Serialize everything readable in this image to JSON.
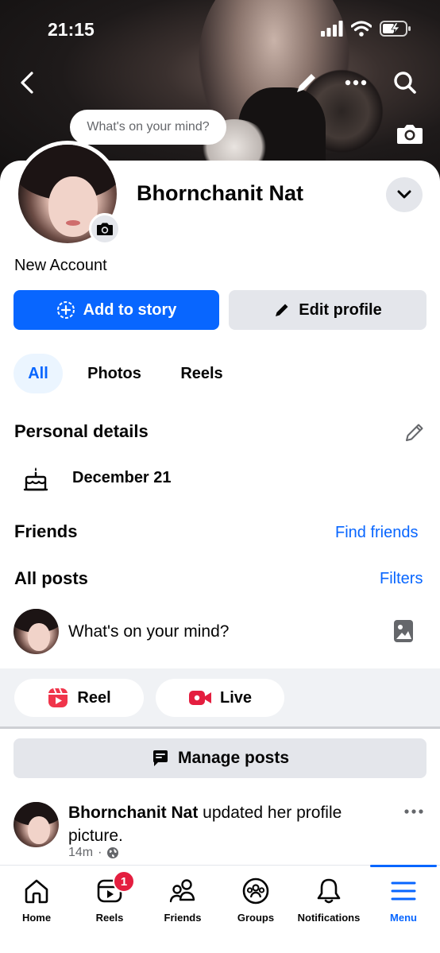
{
  "status_bar": {
    "time": "21:15"
  },
  "cover": {
    "thought_bubble": "What's on your mind?"
  },
  "profile": {
    "name": "Bhornchanit Nat",
    "subtitle": "New Account",
    "add_story_label": "Add to story",
    "edit_profile_label": "Edit profile"
  },
  "tabs": [
    {
      "label": "All",
      "active": true
    },
    {
      "label": "Photos",
      "active": false
    },
    {
      "label": "Reels",
      "active": false
    }
  ],
  "personal_details": {
    "heading": "Personal details",
    "birthday": "December 21"
  },
  "friends": {
    "heading": "Friends",
    "link": "Find friends"
  },
  "posts": {
    "heading": "All posts",
    "filters_link": "Filters",
    "composer_placeholder": "What's on your mind?",
    "reel_label": "Reel",
    "live_label": "Live",
    "manage_label": "Manage posts"
  },
  "post": {
    "author": "Bhornchanit Nat",
    "action": " updated her profile picture.",
    "time": "14m",
    "separator": "·"
  },
  "bottom_nav": [
    {
      "label": "Home",
      "icon": "home-icon",
      "badge": null,
      "active": false
    },
    {
      "label": "Reels",
      "icon": "reels-icon",
      "badge": "1",
      "active": false
    },
    {
      "label": "Friends",
      "icon": "friends-icon",
      "badge": null,
      "active": false
    },
    {
      "label": "Groups",
      "icon": "groups-icon",
      "badge": null,
      "active": false
    },
    {
      "label": "Notifications",
      "icon": "bell-icon",
      "badge": null,
      "active": false
    },
    {
      "label": "Menu",
      "icon": "menu-icon",
      "badge": null,
      "active": true
    }
  ],
  "colors": {
    "accent": "#0866ff",
    "badge": "#e41e3f",
    "surface": "#e4e6eb"
  }
}
